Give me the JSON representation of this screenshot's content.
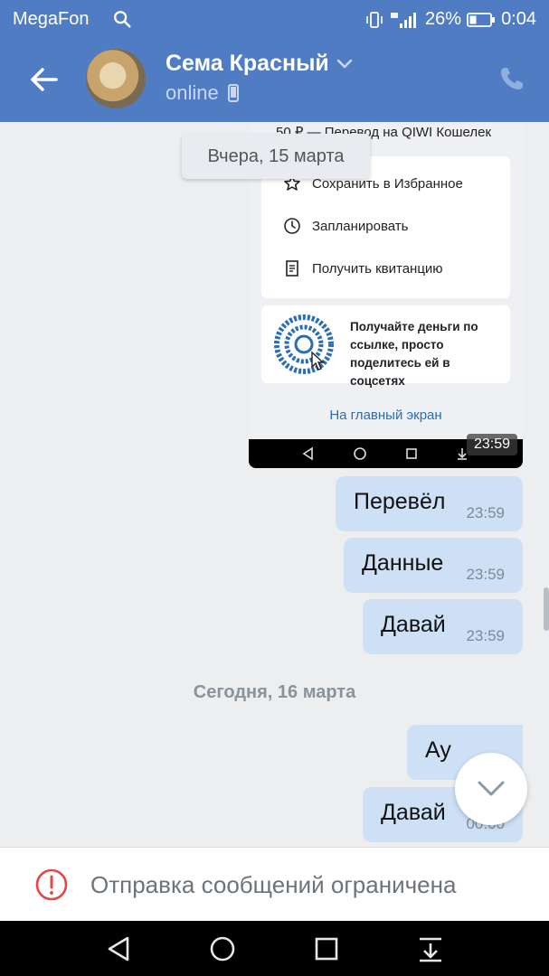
{
  "status_bar": {
    "carrier": "MegaFon",
    "battery": "26%",
    "time": "0:04"
  },
  "header": {
    "contact_name": "Сема Красный",
    "presence": "online"
  },
  "screenshot_attachment": {
    "top_strip": "50 ₽ — Перевод на QIWI Кошелек",
    "actions": [
      {
        "label": "Сохранить в Избранное",
        "icon": "star-icon"
      },
      {
        "label": "Запланировать",
        "icon": "clock-icon"
      },
      {
        "label": "Получить квитанцию",
        "icon": "receipt-icon"
      }
    ],
    "promo_text": "Получайте деньги по ссылке, просто поделитесь ей в соцсетях",
    "promo_spiral_text": "https://qiwi.com/p/номертелефона",
    "home_link": "На главный экран",
    "time": "23:59"
  },
  "date_yesterday": "Вчера, 15 марта",
  "date_today": "Сегодня, 16 марта",
  "messages": [
    {
      "text": "Перевёл",
      "time": "23:59"
    },
    {
      "text": "Данные",
      "time": "23:59"
    },
    {
      "text": "Давай",
      "time": "23:59"
    },
    {
      "text": "Ау",
      "time": ""
    },
    {
      "text": "Давай",
      "time": "00:00"
    }
  ],
  "restriction": {
    "text": "Отправка сообщений ограничена"
  },
  "colors": {
    "header_bg": "#4f7cc2",
    "bubble_out": "#cde0f6",
    "chat_bg": "#edeef0",
    "warning": "#e64646"
  }
}
